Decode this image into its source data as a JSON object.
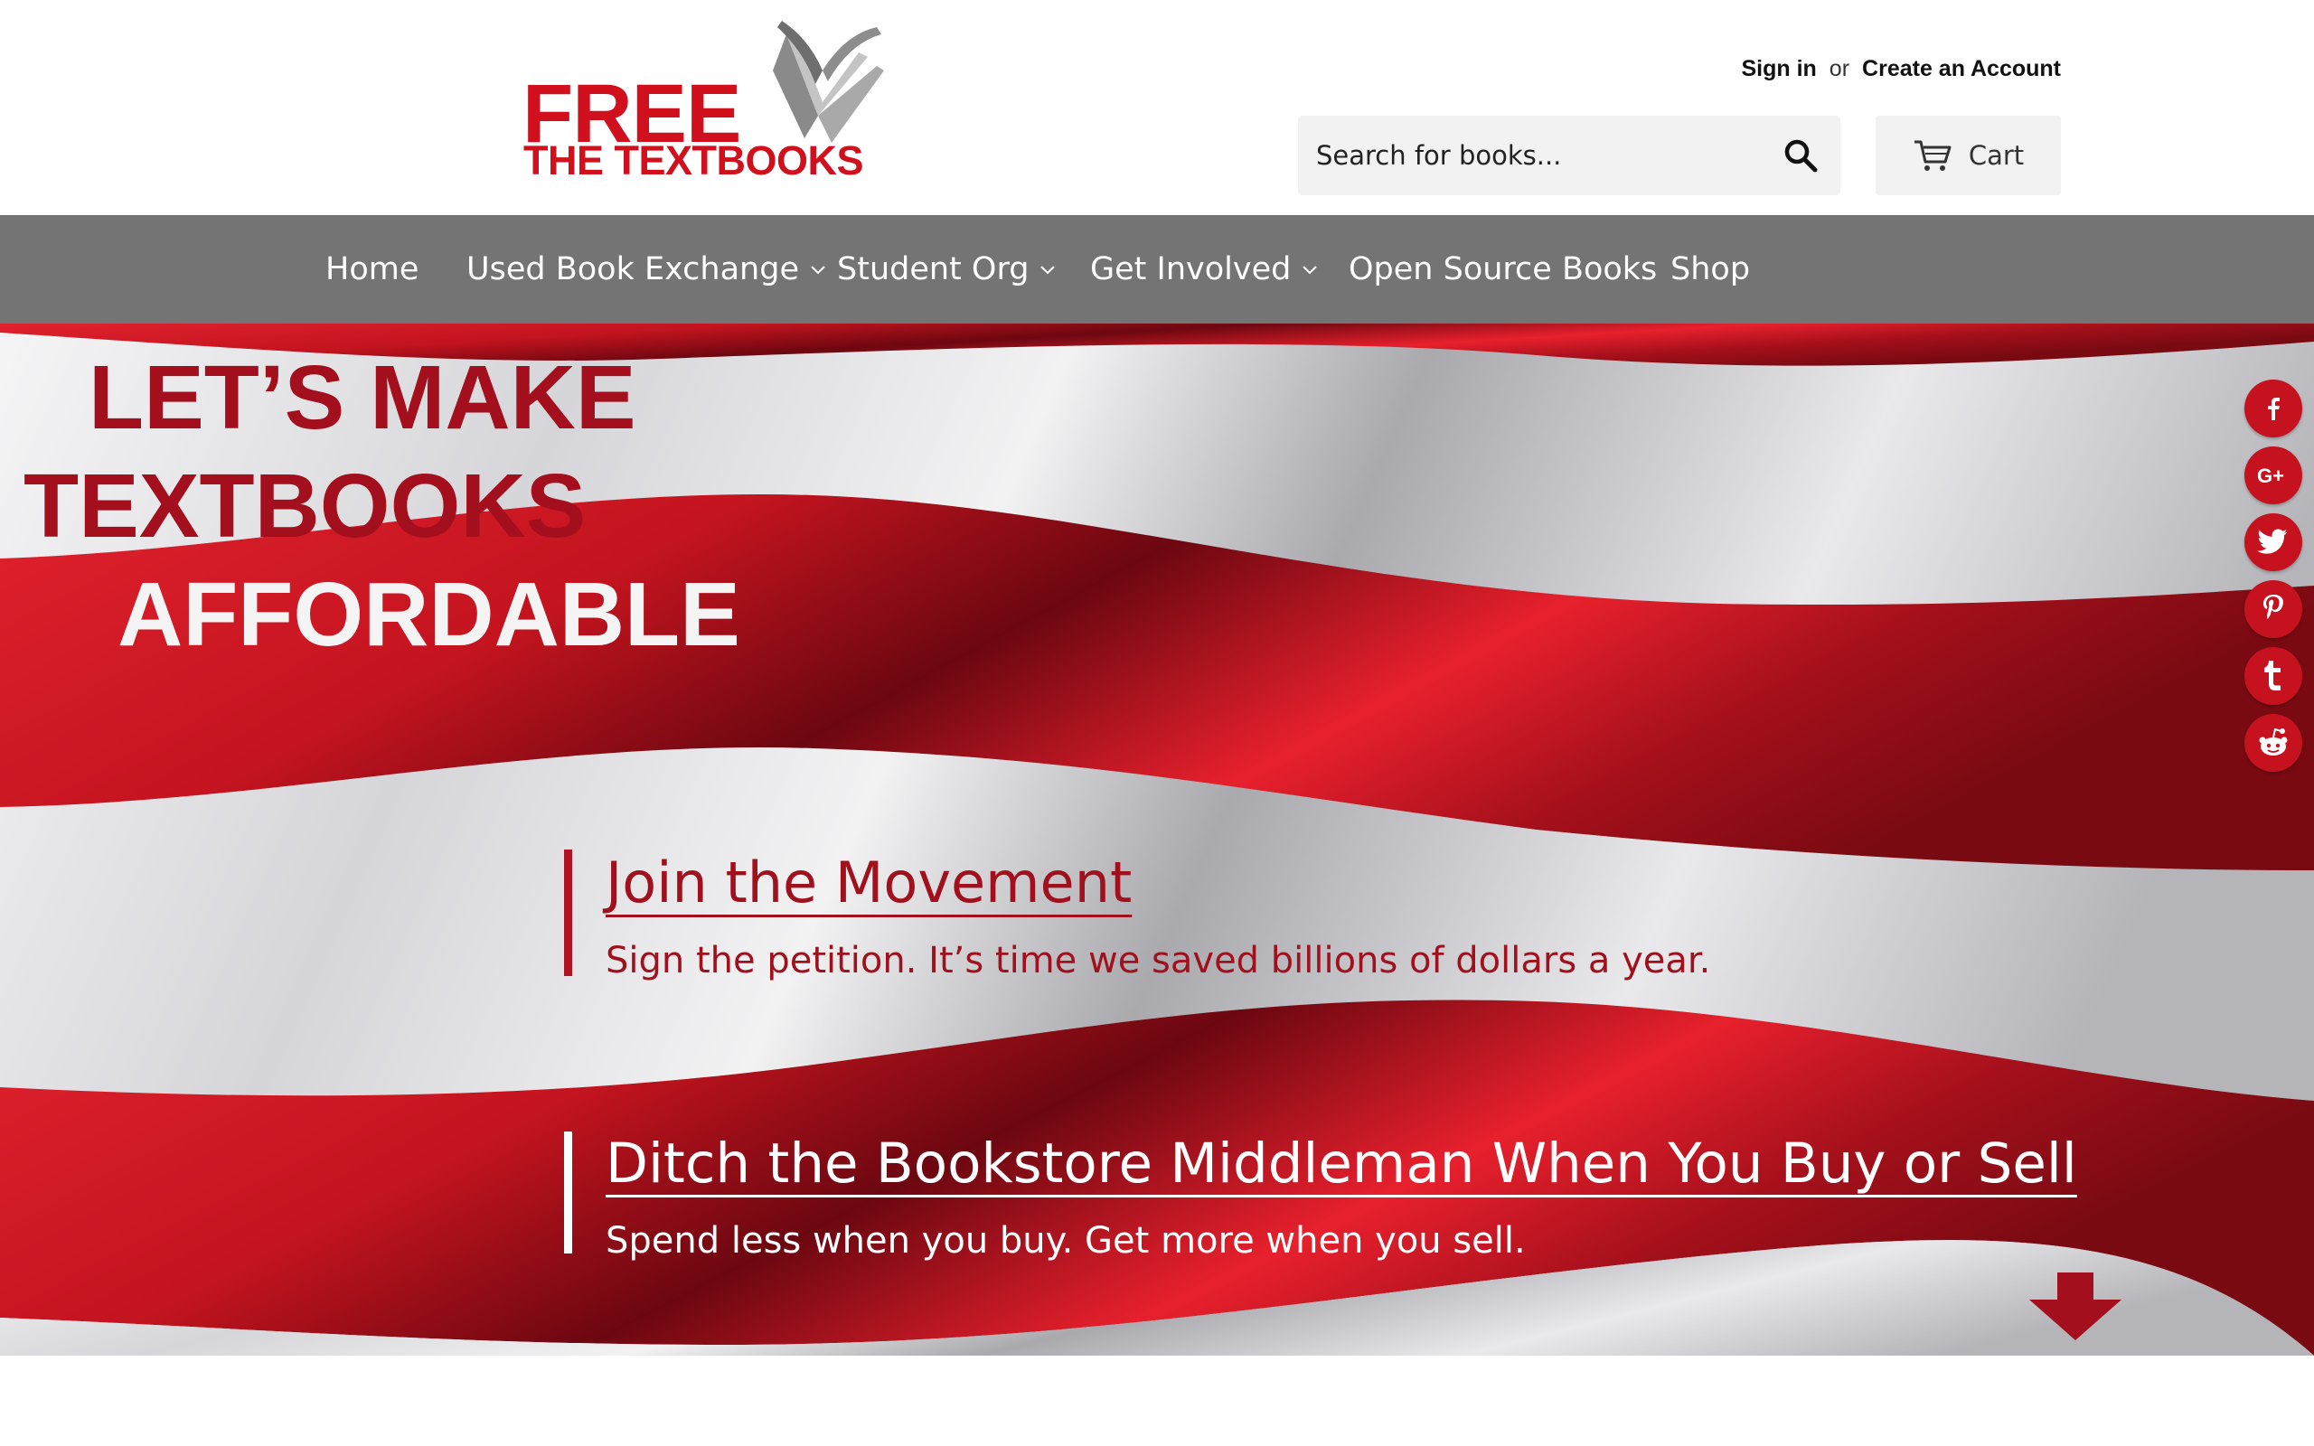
{
  "header": {
    "logo": {
      "line1": "FREE",
      "line2": "THE TEXTBOOKS"
    },
    "account": {
      "sign_in": "Sign in",
      "or": "or",
      "create": "Create an Account"
    },
    "search": {
      "placeholder": "Search for books..."
    },
    "cart": {
      "label": "Cart"
    }
  },
  "nav": {
    "items": [
      {
        "label": "Home",
        "has_dropdown": false
      },
      {
        "label": "Used Book Exchange",
        "has_dropdown": true
      },
      {
        "label": "Student Org",
        "has_dropdown": true
      },
      {
        "label": "Get Involved",
        "has_dropdown": true
      },
      {
        "label": "Open Source Books",
        "has_dropdown": false
      },
      {
        "label": "Shop",
        "has_dropdown": false
      }
    ]
  },
  "hero": {
    "headline": [
      "LET’S MAKE",
      "TEXTBOOKS",
      "AFFORDABLE"
    ],
    "cta1": {
      "title": "Join the Movement",
      "subtitle": "Sign the petition. It’s time we saved billions of dollars a year."
    },
    "cta2": {
      "title": "Ditch the Bookstore Middleman When You Buy or Sell",
      "subtitle": "Spend less when you buy. Get more when you sell."
    }
  },
  "social": [
    "facebook-icon",
    "google-plus-icon",
    "twitter-icon",
    "pinterest-icon",
    "tumblr-icon",
    "reddit-icon"
  ],
  "colors": {
    "brand_red": "#d0101c",
    "nav_gray": "#747474",
    "dark_red": "#a30f1c"
  }
}
